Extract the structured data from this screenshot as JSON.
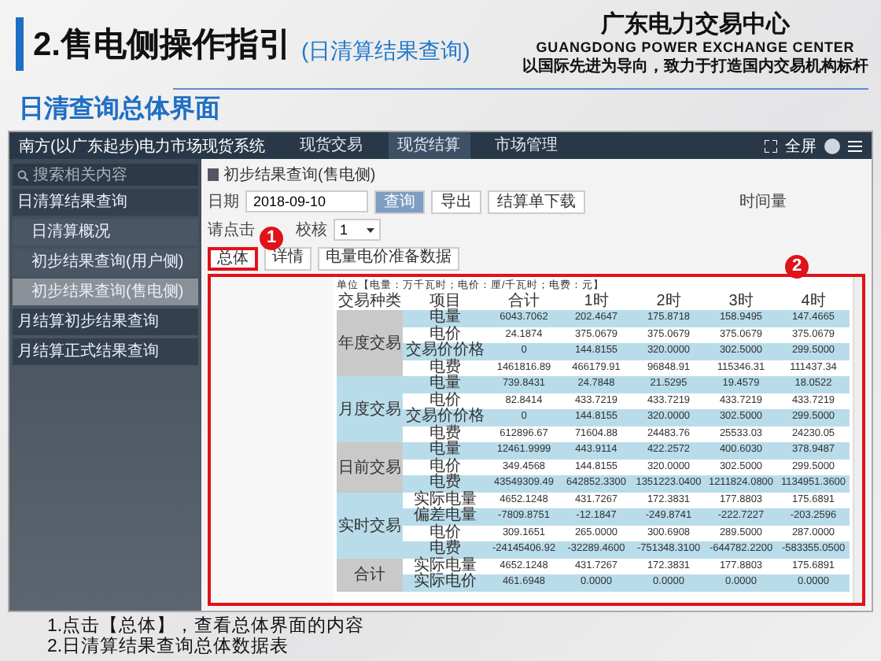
{
  "slide": {
    "title": "2.售电侧操作指引",
    "title_note": "(日清算结果查询)",
    "org_name": "广东电力交易中心",
    "org_name_en": "GUANGDONG POWER EXCHANGE CENTER",
    "org_motto": "以国际先进为导向，致力于打造国内交易机构标杆",
    "subtitle": "日清查询总体界面"
  },
  "app": {
    "system_name": "南方(以广东起步)电力市场现货系统",
    "nav": [
      {
        "label": "现货交易",
        "selected": false
      },
      {
        "label": "现货结算",
        "selected": true
      },
      {
        "label": "市场管理",
        "selected": false
      }
    ],
    "fullscreen": "全屏",
    "sidebar": {
      "search_placeholder": "搜索相关内容",
      "items": [
        {
          "label": "日清算结果查询",
          "selected": false,
          "children": [
            {
              "label": "日清算概况",
              "selected": false
            },
            {
              "label": "初步结果查询(用户侧)",
              "selected": false
            },
            {
              "label": "初步结果查询(售电侧)",
              "selected": true
            }
          ]
        },
        {
          "label": "月结算初步结果查询",
          "selected": false
        },
        {
          "label": "月结算正式结果查询",
          "selected": false
        }
      ]
    },
    "panel_title": "初步结果查询(售电侧)",
    "date_label": "日期",
    "date_value": "2018-09-10",
    "buttons": [
      "查询",
      "导出",
      "结算单下载"
    ],
    "right_label": "时间量",
    "hint_label": "请点击",
    "check_label": "校核",
    "check_value": "1",
    "tabs": [
      {
        "label": "总体",
        "selected": true
      },
      {
        "label": "详情",
        "selected": false
      },
      {
        "label": "电量电价准备数据",
        "selected": false
      }
    ],
    "callouts": [
      "1",
      "2"
    ],
    "unit_note": "单位【电量：万千瓦时；电价：厘/千瓦时；电费：元】",
    "table": {
      "columns": [
        "交易种类",
        "项目",
        "合计",
        "1时",
        "2时",
        "3时",
        "4时"
      ],
      "groups": [
        {
          "label": "年度交易",
          "rows": [
            [
              "电量",
              "6043.7062",
              "202.4647",
              "175.8718",
              "158.9495",
              "147.4665"
            ],
            [
              "电价",
              "24.1874",
              "375.0679",
              "375.0679",
              "375.0679",
              "375.0679"
            ],
            [
              "交易价价格",
              "0",
              "144.8155",
              "320.0000",
              "302.5000",
              "299.5000"
            ],
            [
              "电费",
              "1461816.89",
              "466179.91",
              "96848.91",
              "115346.31",
              "111437.34"
            ]
          ]
        },
        {
          "label": "月度交易",
          "rows": [
            [
              "电量",
              "739.8431",
              "24.7848",
              "21.5295",
              "19.4579",
              "18.0522"
            ],
            [
              "电价",
              "82.8414",
              "433.7219",
              "433.7219",
              "433.7219",
              "433.7219"
            ],
            [
              "交易价价格",
              "0",
              "144.8155",
              "320.0000",
              "302.5000",
              "299.5000"
            ],
            [
              "电费",
              "612896.67",
              "71604.88",
              "24483.76",
              "25533.03",
              "24230.05"
            ]
          ]
        },
        {
          "label": "日前交易",
          "rows": [
            [
              "电量",
              "12461.9999",
              "443.9114",
              "422.2572",
              "400.6030",
              "378.9487"
            ],
            [
              "电价",
              "349.4568",
              "144.8155",
              "320.0000",
              "302.5000",
              "299.5000"
            ],
            [
              "电费",
              "43549309.49",
              "642852.3300",
              "1351223.0400",
              "1211824.0800",
              "1134951.3600"
            ]
          ]
        },
        {
          "label": "实时交易",
          "rows": [
            [
              "实际电量",
              "4652.1248",
              "431.7267",
              "172.3831",
              "177.8803",
              "175.6891"
            ],
            [
              "偏差电量",
              "-7809.8751",
              "-12.1847",
              "-249.8741",
              "-222.7227",
              "-203.2596"
            ],
            [
              "电价",
              "309.1651",
              "265.0000",
              "300.6908",
              "289.5000",
              "287.0000"
            ],
            [
              "电费",
              "-24145406.92",
              "-32289.4600",
              "-751348.3100",
              "-644782.2200",
              "-583355.0500"
            ]
          ]
        },
        {
          "label": "合计",
          "rows": [
            [
              "实际电量",
              "4652.1248",
              "431.7267",
              "172.3831",
              "177.8803",
              "175.6891"
            ],
            [
              "实际电价",
              "461.6948",
              "0.0000",
              "0.0000",
              "0.0000",
              "0.0000"
            ]
          ]
        }
      ]
    }
  },
  "notes": [
    "1.点击【总体】，查看总体界面的内容",
    "2.日清算结果查询总体数据表"
  ]
}
